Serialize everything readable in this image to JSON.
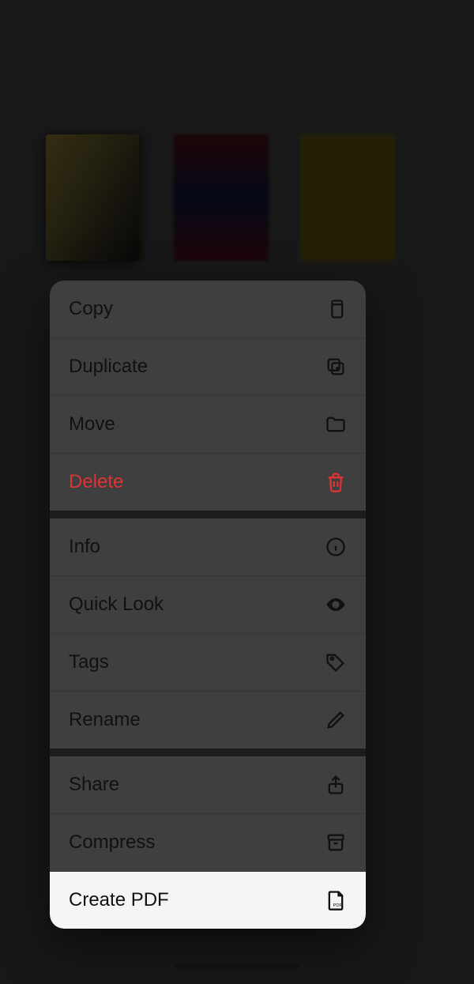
{
  "menu": {
    "copy": "Copy",
    "duplicate": "Duplicate",
    "move": "Move",
    "delete": "Delete",
    "info": "Info",
    "quick_look": "Quick Look",
    "tags": "Tags",
    "rename": "Rename",
    "share": "Share",
    "compress": "Compress",
    "create_pdf": "Create PDF"
  }
}
